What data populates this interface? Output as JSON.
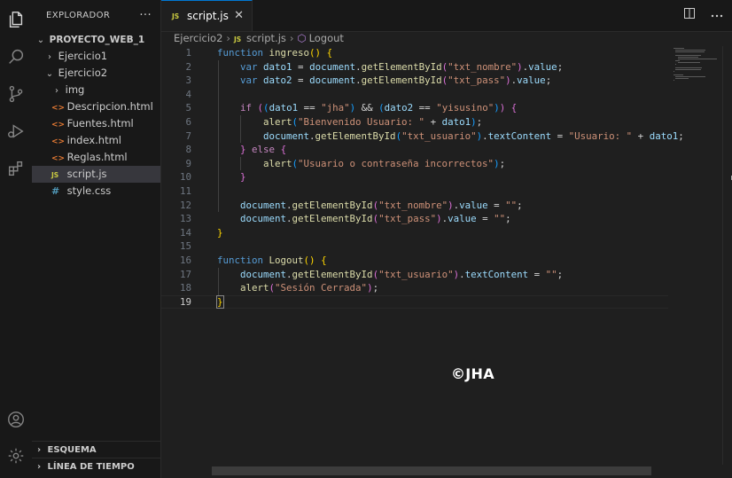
{
  "explorer": {
    "title": "EXPLORADOR",
    "more": "···",
    "project": "PROYECTO_WEB_1",
    "items": [
      {
        "label": "Ejercicio1",
        "type": "folder"
      },
      {
        "label": "Ejercicio2",
        "type": "folder"
      },
      {
        "label": "img",
        "type": "folder"
      },
      {
        "label": "Descripcion.html",
        "type": "html"
      },
      {
        "label": "Fuentes.html",
        "type": "html"
      },
      {
        "label": "index.html",
        "type": "html"
      },
      {
        "label": "Reglas.html",
        "type": "html"
      },
      {
        "label": "script.js",
        "type": "js"
      },
      {
        "label": "style.css",
        "type": "css"
      }
    ],
    "outline": "ESQUEMA",
    "timeline": "LÍNEA DE TIEMPO"
  },
  "tab": {
    "icon": "JS",
    "label": "script.js",
    "close": "✕"
  },
  "breadcrumb": {
    "folder": "Ejercicio2",
    "file": "script.js",
    "symbol": "Logout"
  },
  "file_icons": {
    "html": "<>",
    "js": "JS",
    "css": "#"
  },
  "icons": {
    "explorer": "files-icon",
    "search": "search-icon",
    "scm": "source-control-icon",
    "debug": "run-debug-icon",
    "extensions": "extensions-icon",
    "account": "account-icon",
    "settings": "gear-icon"
  },
  "colors": {
    "keyword": "#569cd6",
    "control": "#c586c0",
    "function": "#dcdcaa",
    "variable": "#9cdcfe",
    "string": "#ce9178",
    "accent": "#0078d4"
  },
  "editor": {
    "current_line": 19,
    "lines": [
      {
        "n": "1",
        "tokens": [
          [
            "kw",
            "function "
          ],
          [
            "fn",
            "ingreso"
          ],
          [
            "br1",
            "()"
          ],
          [
            "op",
            " "
          ],
          [
            "br1",
            "{"
          ]
        ]
      },
      {
        "n": "2",
        "tokens": [
          [
            "op",
            "    "
          ],
          [
            "kw",
            "var "
          ],
          [
            "var",
            "dato1"
          ],
          [
            "op",
            " = "
          ],
          [
            "var",
            "document"
          ],
          [
            "op",
            "."
          ],
          [
            "fn",
            "getElementById"
          ],
          [
            "br2",
            "("
          ],
          [
            "str",
            "\"txt_nombre\""
          ],
          [
            "br2",
            ")"
          ],
          [
            "op",
            "."
          ],
          [
            "var",
            "value"
          ],
          [
            "op",
            ";"
          ]
        ]
      },
      {
        "n": "3",
        "tokens": [
          [
            "op",
            "    "
          ],
          [
            "kw",
            "var "
          ],
          [
            "var",
            "dato2"
          ],
          [
            "op",
            " = "
          ],
          [
            "var",
            "document"
          ],
          [
            "op",
            "."
          ],
          [
            "fn",
            "getElementById"
          ],
          [
            "br2",
            "("
          ],
          [
            "str",
            "\"txt_pass\""
          ],
          [
            "br2",
            ")"
          ],
          [
            "op",
            "."
          ],
          [
            "var",
            "value"
          ],
          [
            "op",
            ";"
          ]
        ]
      },
      {
        "n": "4",
        "tokens": []
      },
      {
        "n": "5",
        "tokens": [
          [
            "op",
            "    "
          ],
          [
            "ctl",
            "if "
          ],
          [
            "br2",
            "("
          ],
          [
            "br3",
            "("
          ],
          [
            "var",
            "dato1"
          ],
          [
            "op",
            " == "
          ],
          [
            "str",
            "\"jha\""
          ],
          [
            "br3",
            ")"
          ],
          [
            "op",
            " && "
          ],
          [
            "br3",
            "("
          ],
          [
            "var",
            "dato2"
          ],
          [
            "op",
            " == "
          ],
          [
            "str",
            "\"yisusino\""
          ],
          [
            "br3",
            ")"
          ],
          [
            "br2",
            ")"
          ],
          [
            "op",
            " "
          ],
          [
            "br2",
            "{"
          ]
        ]
      },
      {
        "n": "6",
        "tokens": [
          [
            "op",
            "        "
          ],
          [
            "fn",
            "alert"
          ],
          [
            "br3",
            "("
          ],
          [
            "str",
            "\"Bienvenido Usuario: \""
          ],
          [
            "op",
            " + "
          ],
          [
            "var",
            "dato1"
          ],
          [
            "br3",
            ")"
          ],
          [
            "op",
            ";"
          ]
        ]
      },
      {
        "n": "7",
        "tokens": [
          [
            "op",
            "        "
          ],
          [
            "var",
            "document"
          ],
          [
            "op",
            "."
          ],
          [
            "fn",
            "getElementById"
          ],
          [
            "br3",
            "("
          ],
          [
            "str",
            "\"txt_usuario\""
          ],
          [
            "br3",
            ")"
          ],
          [
            "op",
            "."
          ],
          [
            "var",
            "textContent"
          ],
          [
            "op",
            " = "
          ],
          [
            "str",
            "\"Usuario: \""
          ],
          [
            "op",
            " + "
          ],
          [
            "var",
            "dato1"
          ],
          [
            "op",
            ";"
          ]
        ]
      },
      {
        "n": "8",
        "tokens": [
          [
            "op",
            "    "
          ],
          [
            "br2",
            "}"
          ],
          [
            "op",
            " "
          ],
          [
            "ctl",
            "else "
          ],
          [
            "br2",
            "{"
          ]
        ]
      },
      {
        "n": "9",
        "tokens": [
          [
            "op",
            "        "
          ],
          [
            "fn",
            "alert"
          ],
          [
            "br3",
            "("
          ],
          [
            "str",
            "\"Usuario o contraseña incorrectos\""
          ],
          [
            "br3",
            ")"
          ],
          [
            "op",
            ";"
          ]
        ]
      },
      {
        "n": "10",
        "tokens": [
          [
            "op",
            "    "
          ],
          [
            "br2",
            "}"
          ]
        ]
      },
      {
        "n": "11",
        "tokens": []
      },
      {
        "n": "12",
        "tokens": [
          [
            "op",
            "    "
          ],
          [
            "var",
            "document"
          ],
          [
            "op",
            "."
          ],
          [
            "fn",
            "getElementById"
          ],
          [
            "br2",
            "("
          ],
          [
            "str",
            "\"txt_nombre\""
          ],
          [
            "br2",
            ")"
          ],
          [
            "op",
            "."
          ],
          [
            "var",
            "value"
          ],
          [
            "op",
            " = "
          ],
          [
            "str",
            "\"\""
          ],
          [
            "op",
            ";"
          ]
        ]
      },
      {
        "n": "13",
        "tokens": [
          [
            "op",
            "    "
          ],
          [
            "var",
            "document"
          ],
          [
            "op",
            "."
          ],
          [
            "fn",
            "getElementById"
          ],
          [
            "br2",
            "("
          ],
          [
            "str",
            "\"txt_pass\""
          ],
          [
            "br2",
            ")"
          ],
          [
            "op",
            "."
          ],
          [
            "var",
            "value"
          ],
          [
            "op",
            " = "
          ],
          [
            "str",
            "\"\""
          ],
          [
            "op",
            ";"
          ]
        ]
      },
      {
        "n": "14",
        "tokens": [
          [
            "br1",
            "}"
          ]
        ]
      },
      {
        "n": "15",
        "tokens": []
      },
      {
        "n": "16",
        "tokens": [
          [
            "kw",
            "function "
          ],
          [
            "fn",
            "Logout"
          ],
          [
            "br1",
            "()"
          ],
          [
            "op",
            " "
          ],
          [
            "br1",
            "{"
          ]
        ]
      },
      {
        "n": "17",
        "tokens": [
          [
            "op",
            "    "
          ],
          [
            "var",
            "document"
          ],
          [
            "op",
            "."
          ],
          [
            "fn",
            "getElementById"
          ],
          [
            "br2",
            "("
          ],
          [
            "str",
            "\"txt_usuario\""
          ],
          [
            "br2",
            ")"
          ],
          [
            "op",
            "."
          ],
          [
            "var",
            "textContent"
          ],
          [
            "op",
            " = "
          ],
          [
            "str",
            "\"\""
          ],
          [
            "op",
            ";"
          ]
        ]
      },
      {
        "n": "18",
        "tokens": [
          [
            "op",
            "    "
          ],
          [
            "fn",
            "alert"
          ],
          [
            "br2",
            "("
          ],
          [
            "str",
            "\"Sesión Cerrada\""
          ],
          [
            "br2",
            ")"
          ],
          [
            "op",
            ";"
          ]
        ]
      },
      {
        "n": "19",
        "tokens": [
          [
            "br1",
            "}"
          ]
        ]
      }
    ]
  },
  "watermark": "©JHA"
}
